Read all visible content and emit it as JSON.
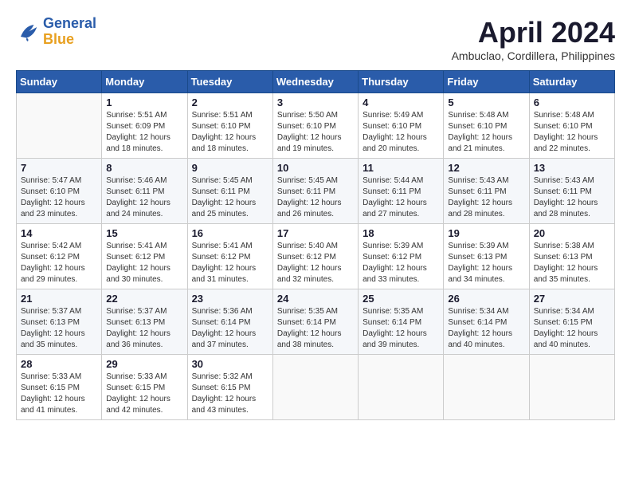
{
  "header": {
    "logo_line1": "General",
    "logo_line2": "Blue",
    "month_year": "April 2024",
    "location": "Ambuclao, Cordillera, Philippines"
  },
  "weekdays": [
    "Sunday",
    "Monday",
    "Tuesday",
    "Wednesday",
    "Thursday",
    "Friday",
    "Saturday"
  ],
  "weeks": [
    [
      {
        "day": "",
        "info": ""
      },
      {
        "day": "1",
        "info": "Sunrise: 5:51 AM\nSunset: 6:09 PM\nDaylight: 12 hours\nand 18 minutes."
      },
      {
        "day": "2",
        "info": "Sunrise: 5:51 AM\nSunset: 6:10 PM\nDaylight: 12 hours\nand 18 minutes."
      },
      {
        "day": "3",
        "info": "Sunrise: 5:50 AM\nSunset: 6:10 PM\nDaylight: 12 hours\nand 19 minutes."
      },
      {
        "day": "4",
        "info": "Sunrise: 5:49 AM\nSunset: 6:10 PM\nDaylight: 12 hours\nand 20 minutes."
      },
      {
        "day": "5",
        "info": "Sunrise: 5:48 AM\nSunset: 6:10 PM\nDaylight: 12 hours\nand 21 minutes."
      },
      {
        "day": "6",
        "info": "Sunrise: 5:48 AM\nSunset: 6:10 PM\nDaylight: 12 hours\nand 22 minutes."
      }
    ],
    [
      {
        "day": "7",
        "info": "Sunrise: 5:47 AM\nSunset: 6:10 PM\nDaylight: 12 hours\nand 23 minutes."
      },
      {
        "day": "8",
        "info": "Sunrise: 5:46 AM\nSunset: 6:11 PM\nDaylight: 12 hours\nand 24 minutes."
      },
      {
        "day": "9",
        "info": "Sunrise: 5:45 AM\nSunset: 6:11 PM\nDaylight: 12 hours\nand 25 minutes."
      },
      {
        "day": "10",
        "info": "Sunrise: 5:45 AM\nSunset: 6:11 PM\nDaylight: 12 hours\nand 26 minutes."
      },
      {
        "day": "11",
        "info": "Sunrise: 5:44 AM\nSunset: 6:11 PM\nDaylight: 12 hours\nand 27 minutes."
      },
      {
        "day": "12",
        "info": "Sunrise: 5:43 AM\nSunset: 6:11 PM\nDaylight: 12 hours\nand 28 minutes."
      },
      {
        "day": "13",
        "info": "Sunrise: 5:43 AM\nSunset: 6:11 PM\nDaylight: 12 hours\nand 28 minutes."
      }
    ],
    [
      {
        "day": "14",
        "info": "Sunrise: 5:42 AM\nSunset: 6:12 PM\nDaylight: 12 hours\nand 29 minutes."
      },
      {
        "day": "15",
        "info": "Sunrise: 5:41 AM\nSunset: 6:12 PM\nDaylight: 12 hours\nand 30 minutes."
      },
      {
        "day": "16",
        "info": "Sunrise: 5:41 AM\nSunset: 6:12 PM\nDaylight: 12 hours\nand 31 minutes."
      },
      {
        "day": "17",
        "info": "Sunrise: 5:40 AM\nSunset: 6:12 PM\nDaylight: 12 hours\nand 32 minutes."
      },
      {
        "day": "18",
        "info": "Sunrise: 5:39 AM\nSunset: 6:12 PM\nDaylight: 12 hours\nand 33 minutes."
      },
      {
        "day": "19",
        "info": "Sunrise: 5:39 AM\nSunset: 6:13 PM\nDaylight: 12 hours\nand 34 minutes."
      },
      {
        "day": "20",
        "info": "Sunrise: 5:38 AM\nSunset: 6:13 PM\nDaylight: 12 hours\nand 35 minutes."
      }
    ],
    [
      {
        "day": "21",
        "info": "Sunrise: 5:37 AM\nSunset: 6:13 PM\nDaylight: 12 hours\nand 35 minutes."
      },
      {
        "day": "22",
        "info": "Sunrise: 5:37 AM\nSunset: 6:13 PM\nDaylight: 12 hours\nand 36 minutes."
      },
      {
        "day": "23",
        "info": "Sunrise: 5:36 AM\nSunset: 6:14 PM\nDaylight: 12 hours\nand 37 minutes."
      },
      {
        "day": "24",
        "info": "Sunrise: 5:35 AM\nSunset: 6:14 PM\nDaylight: 12 hours\nand 38 minutes."
      },
      {
        "day": "25",
        "info": "Sunrise: 5:35 AM\nSunset: 6:14 PM\nDaylight: 12 hours\nand 39 minutes."
      },
      {
        "day": "26",
        "info": "Sunrise: 5:34 AM\nSunset: 6:14 PM\nDaylight: 12 hours\nand 40 minutes."
      },
      {
        "day": "27",
        "info": "Sunrise: 5:34 AM\nSunset: 6:15 PM\nDaylight: 12 hours\nand 40 minutes."
      }
    ],
    [
      {
        "day": "28",
        "info": "Sunrise: 5:33 AM\nSunset: 6:15 PM\nDaylight: 12 hours\nand 41 minutes."
      },
      {
        "day": "29",
        "info": "Sunrise: 5:33 AM\nSunset: 6:15 PM\nDaylight: 12 hours\nand 42 minutes."
      },
      {
        "day": "30",
        "info": "Sunrise: 5:32 AM\nSunset: 6:15 PM\nDaylight: 12 hours\nand 43 minutes."
      },
      {
        "day": "",
        "info": ""
      },
      {
        "day": "",
        "info": ""
      },
      {
        "day": "",
        "info": ""
      },
      {
        "day": "",
        "info": ""
      }
    ]
  ]
}
